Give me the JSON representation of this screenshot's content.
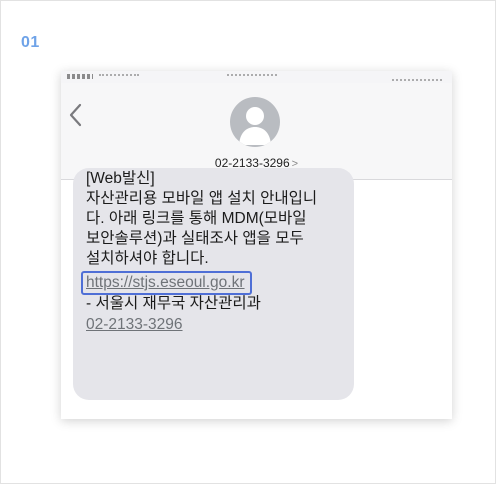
{
  "step": {
    "number": "01"
  },
  "sms": {
    "contact_number": "02-2133-3296",
    "contact_chevron": ">",
    "message": {
      "line1": "[Web발신]",
      "line2": "자산관리용 모바일 앱 설치 안내입니",
      "line3": "다. 아래 링크를 통해 MDM(모바일",
      "line4": "보안솔루션)과 실태조사 앱을 모두",
      "line5": "설치하셔야 합니다.",
      "link": "https://stjs.eseoul.go.kr",
      "sender": "- 서울시 재무국 자산관리과",
      "phone": "02-2133-3296"
    }
  },
  "colors": {
    "step_number": "#6fa3e8",
    "highlight_box": "#4f6fd6",
    "bubble": "#e5e5ea"
  },
  "icons": {
    "back": "chevron-left-icon",
    "avatar": "person-silhouette-icon"
  }
}
